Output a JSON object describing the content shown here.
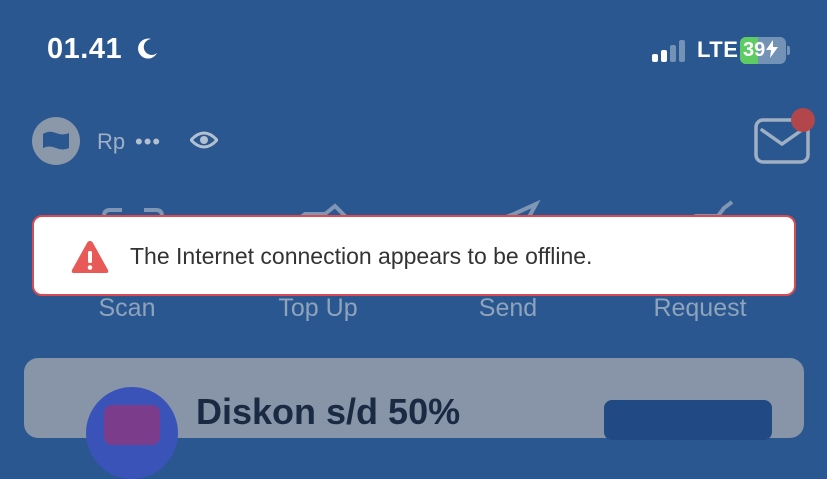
{
  "status_bar": {
    "time": "01.41",
    "network": "LTE",
    "battery": "39",
    "battery_level": 0.39,
    "icons": [
      "moon-icon",
      "signal-icon",
      "battery-charging-icon"
    ]
  },
  "balance": {
    "currency": "Rp",
    "masked": "•••",
    "icons": [
      "avatar-icon",
      "eye-icon",
      "mail-icon"
    ]
  },
  "actions": [
    {
      "label": "Scan",
      "icon": "scan-icon"
    },
    {
      "label": "Top Up",
      "icon": "top-up-icon"
    },
    {
      "label": "Send",
      "icon": "send-icon"
    },
    {
      "label": "Request",
      "icon": "request-icon"
    }
  ],
  "toast": {
    "message": "The Internet connection appears to be offline.",
    "icon": "warning-icon"
  },
  "card": {
    "title": "Diskon s/d 50%"
  },
  "colors": {
    "background": "#2a578f",
    "toast_border": "#d84b52",
    "warning": "#e85a58",
    "battery": "#5ecb63",
    "notification_dot": "#b2464b"
  }
}
